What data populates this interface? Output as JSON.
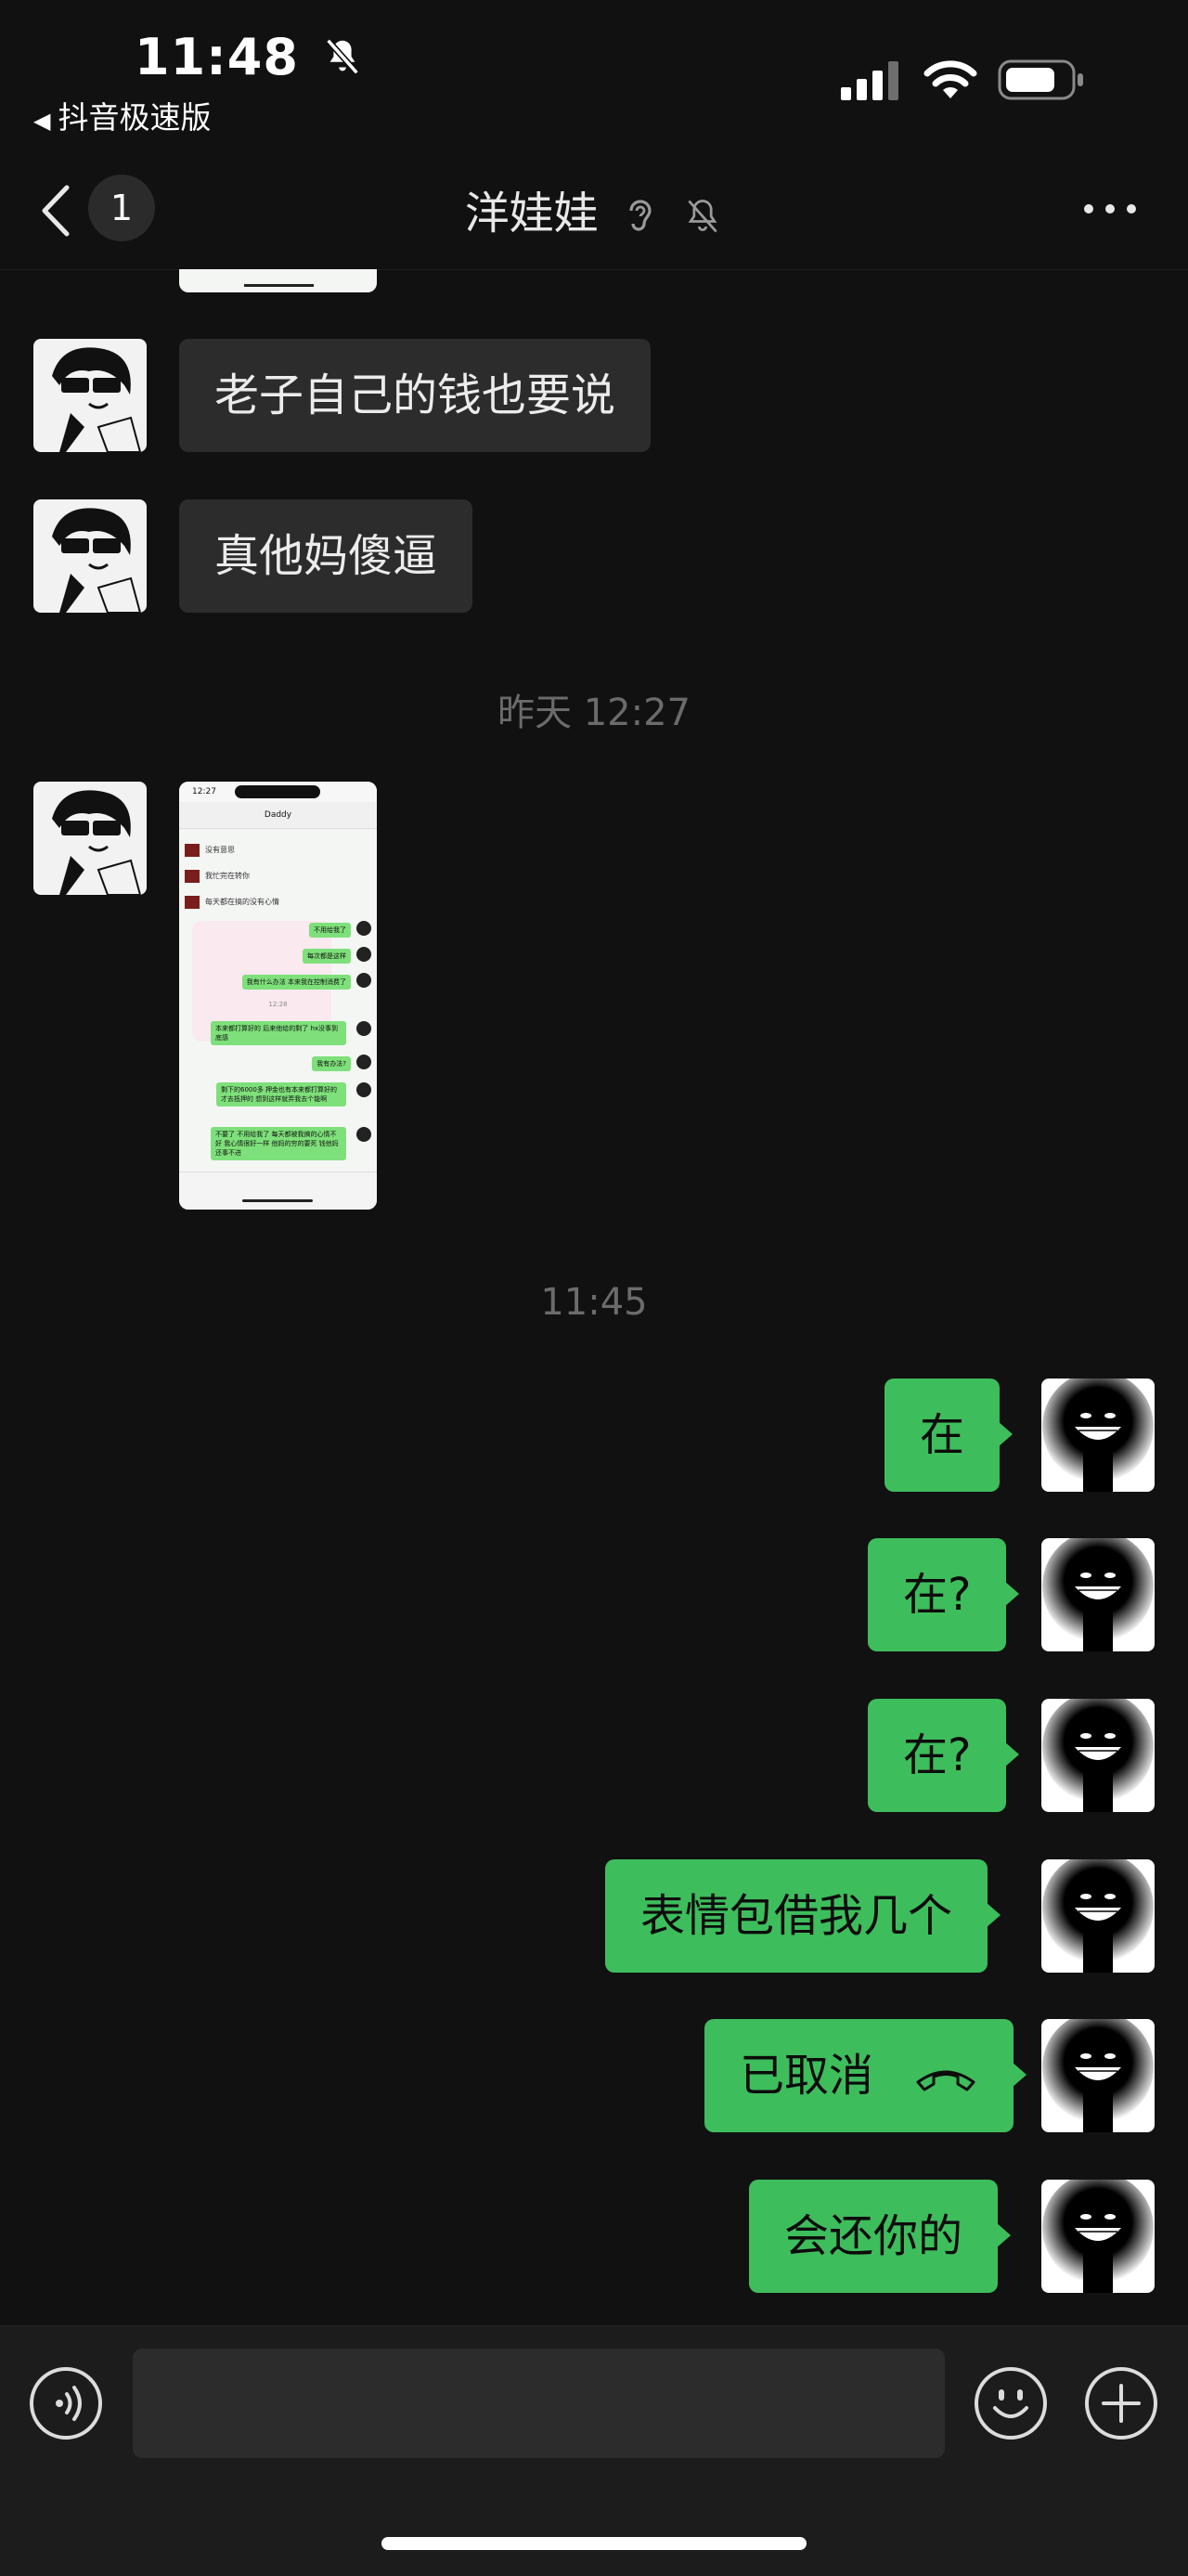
{
  "status_bar": {
    "time": "11:48",
    "back_app": "抖音极速版"
  },
  "nav": {
    "unread_count": "1",
    "title": "洋娃娃"
  },
  "messages": {
    "left1": "老子自己的钱也要说",
    "left2": "真他妈傻逼",
    "ts1": "昨天 12:27",
    "ts2": "11:45",
    "right1": "在",
    "right2": "在?",
    "right3": "在?",
    "right4": "表情包借我几个",
    "right5": "已取消",
    "right6": "会还你的"
  },
  "screenshot_thumb": {
    "time": "12:27",
    "title": "Daddy",
    "lines": [
      "没有意思",
      "我忙完在转你",
      "每天都在搞的没有心情",
      "不用给我了",
      "每次都是这样",
      "我有什么办法 本来我在控制消费了",
      "12:28",
      "本来都打算好的 后来他给的剩了 hx没事到底感",
      "我有办法?",
      "剩下的6000多 押金也有本来都打算好的才去抵押的 想到这样就弄我去个能啊",
      "不要了 不用给我了 每天都被我搞的心情不好 我心情很好一样 他妈的穷的要死 钱他妈还事不进"
    ]
  },
  "colors": {
    "sent_bubble": "#3ebd5c",
    "received_bubble": "#2c2c2c",
    "background": "#111111"
  }
}
